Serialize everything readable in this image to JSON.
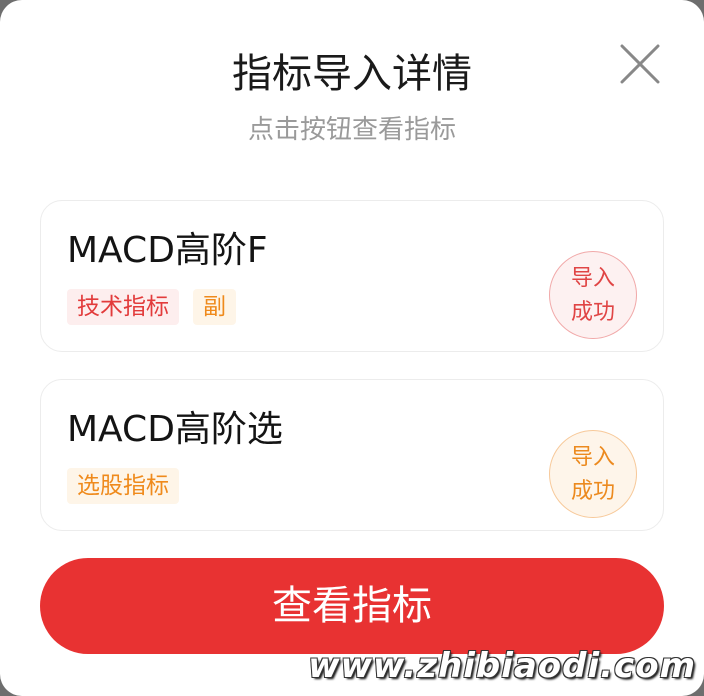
{
  "dialog": {
    "title": "指标导入详情",
    "subtitle": "点击按钮查看指标",
    "close_icon": "close-icon"
  },
  "cards": [
    {
      "name": "MACD高阶F",
      "tags": [
        {
          "label": "技术指标",
          "color": "#e23b3b"
        },
        {
          "label": "副",
          "color": "#ef8a1c"
        }
      ],
      "status_line1": "导入",
      "status_line2": "成功",
      "status_color": "#e04545"
    },
    {
      "name": "MACD高阶选",
      "tags": [
        {
          "label": "选股指标",
          "color": "#ef8a1c"
        }
      ],
      "status_line1": "导入",
      "status_line2": "成功",
      "status_color": "#ec8a1f"
    }
  ],
  "primary_button": {
    "label": "查看指标",
    "color": "#e83232"
  },
  "watermark": "www.zhibiaodi.com"
}
